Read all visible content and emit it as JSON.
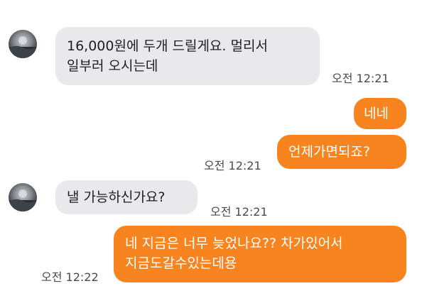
{
  "messages": [
    {
      "direction": "incoming",
      "lines": [
        "16,000원에 두개 드릴게요. 멀리서",
        "일부러 오시는데"
      ],
      "time": "오전 12:21"
    },
    {
      "direction": "outgoing",
      "lines": [
        "네네"
      ]
    },
    {
      "direction": "outgoing",
      "lines": [
        "언제가면되죠?"
      ],
      "time": "오전 12:21"
    },
    {
      "direction": "incoming",
      "lines": [
        "낼 가능하신가요?"
      ],
      "time": "오전 12:21"
    },
    {
      "direction": "outgoing",
      "lines": [
        "네 지금은 너무 늦었나요?? 차가있어서",
        "지금도갈수있는데용"
      ],
      "time": "오전 12:22"
    }
  ],
  "colors": {
    "incoming_bubble": "#e9e9eb",
    "outgoing_bubble": "#f7841f",
    "outgoing_text": "#ffffff",
    "timestamp": "#4a4a4a"
  },
  "icons": {
    "avatar": "avatar-icon"
  }
}
